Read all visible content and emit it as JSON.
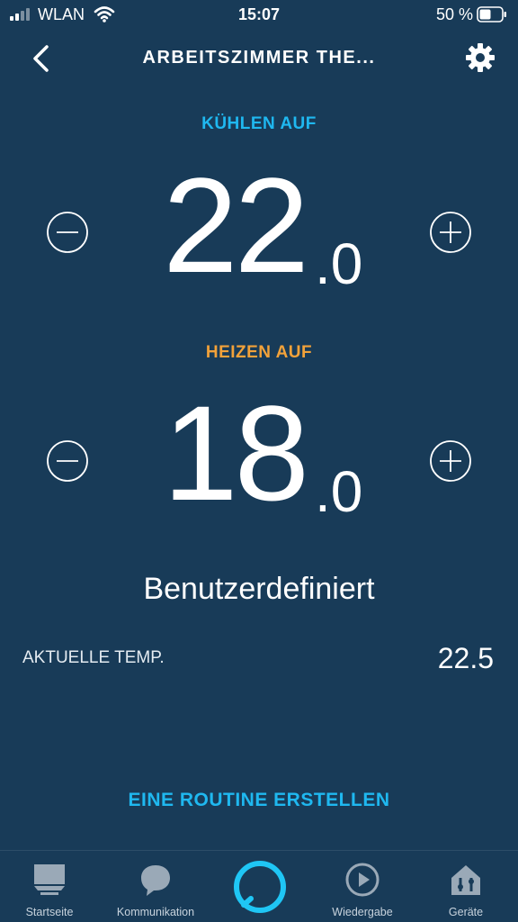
{
  "status_bar": {
    "carrier": "WLAN",
    "time": "15:07",
    "battery": "50 %"
  },
  "header": {
    "title": "ARBEITSZIMMER THE..."
  },
  "cool": {
    "label": "KÜHLEN AUF",
    "value_int": "22",
    "value_dec": ".0"
  },
  "heat": {
    "label": "HEIZEN AUF",
    "value_int": "18",
    "value_dec": ".0"
  },
  "mode": "Benutzerdefiniert",
  "current": {
    "label": "AKTUELLE TEMP.",
    "value": "22.5"
  },
  "routine_link": "EINE ROUTINE ERSTELLEN",
  "tabs": [
    {
      "label": "Startseite",
      "icon": "home-icon"
    },
    {
      "label": "Kommunikation",
      "icon": "chat-icon"
    },
    {
      "label": "",
      "icon": "alexa-icon"
    },
    {
      "label": "Wiedergabe",
      "icon": "play-icon"
    },
    {
      "label": "Geräte",
      "icon": "devices-icon"
    }
  ],
  "colors": {
    "background": "#183b58",
    "accent_blue": "#1fb8f0",
    "heat_orange": "#f2a23a"
  }
}
